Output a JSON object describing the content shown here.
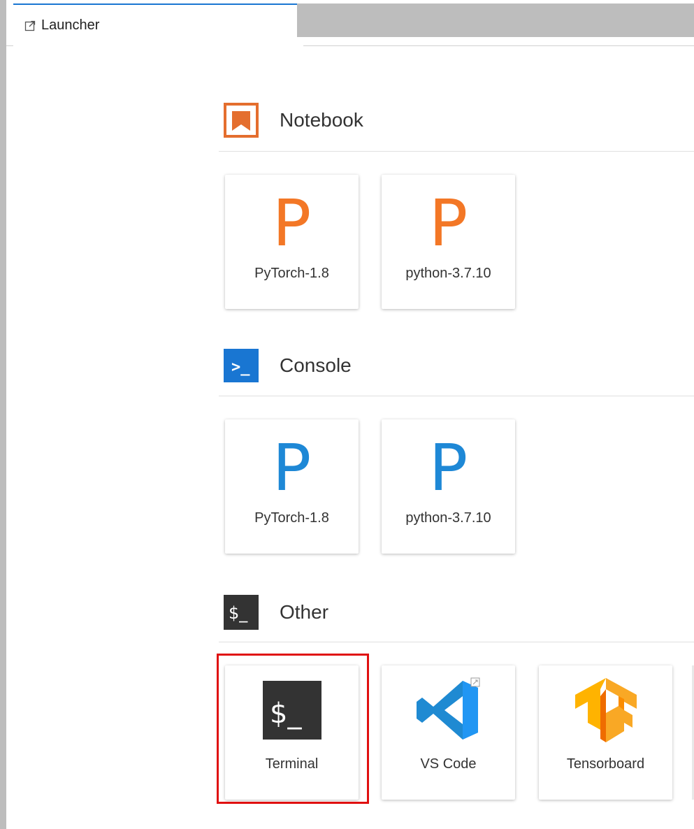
{
  "tab": {
    "label": "Launcher"
  },
  "sections": {
    "notebook": {
      "title": "Notebook"
    },
    "console": {
      "title": "Console"
    },
    "other": {
      "title": "Other"
    }
  },
  "notebook_cards": [
    {
      "letter": "P",
      "label": "PyTorch-1.8"
    },
    {
      "letter": "P",
      "label": "python-3.7.10"
    }
  ],
  "console_cards": [
    {
      "letter": "P",
      "label": "PyTorch-1.8"
    },
    {
      "letter": "P",
      "label": "python-3.7.10"
    }
  ],
  "other_cards": [
    {
      "label": "Terminal",
      "icon": "terminal-icon",
      "glyph": "$_"
    },
    {
      "label": "VS Code",
      "icon": "vscode-icon"
    },
    {
      "label": "Tensorboard",
      "icon": "tensorflow-icon"
    }
  ],
  "icons": {
    "notebook_section": "notebook-icon",
    "console_section": "console-icon",
    "console_glyph": ">_",
    "other_section": "terminal-icon",
    "other_glyph": "$_"
  },
  "colors": {
    "notebook_orange": "#f37726",
    "console_blue": "#1976d2",
    "terminal_dark": "#333333",
    "highlight_red": "#e01010",
    "tab_accent": "#1976d2"
  }
}
